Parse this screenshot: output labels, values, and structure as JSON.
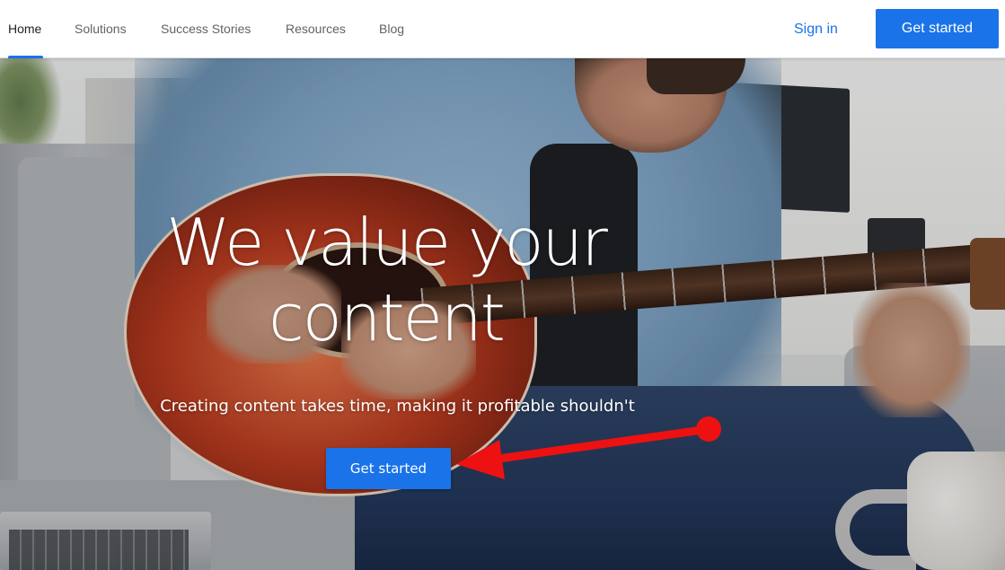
{
  "nav": {
    "items": [
      {
        "label": "Home",
        "active": true
      },
      {
        "label": "Solutions",
        "active": false
      },
      {
        "label": "Success Stories",
        "active": false
      },
      {
        "label": "Resources",
        "active": false
      },
      {
        "label": "Blog",
        "active": false
      }
    ],
    "signin_label": "Sign in",
    "get_started_label": "Get started"
  },
  "hero": {
    "headline_line1": "We value your",
    "headline_line2": "content",
    "subline": "Creating content takes time, making it profitable shouldn't",
    "cta_label": "Get started",
    "background_image": "man-playing-acoustic-guitar-on-sofa"
  },
  "annotation": {
    "type": "red-arrow-pointing-to-cta",
    "color": "#ee1111"
  },
  "colors": {
    "accent": "#1a73e8",
    "nav_text": "#5f6368",
    "nav_active": "#202124"
  }
}
